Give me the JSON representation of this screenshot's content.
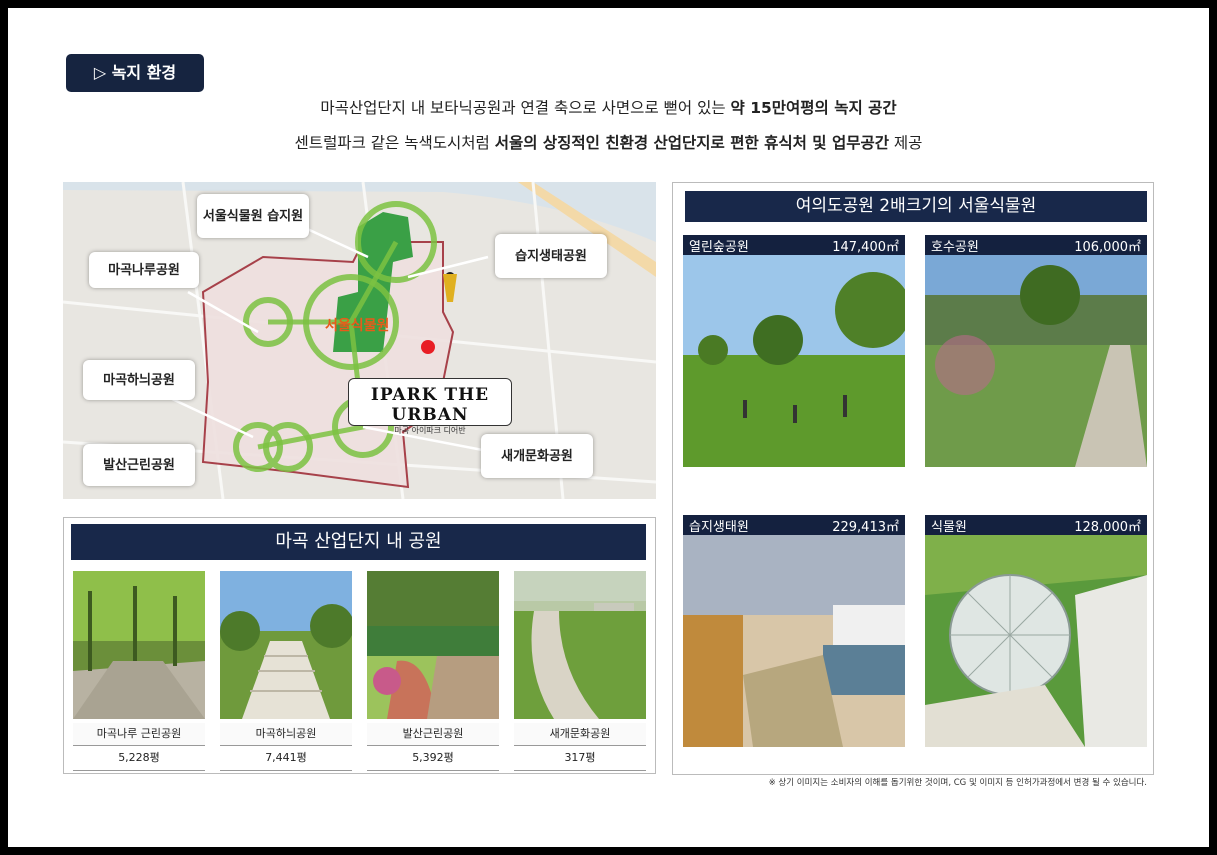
{
  "badge": "▷ 녹지 환경",
  "headline1": {
    "normal": "마곡산업단지 내 보타닉공원과 연결 축으로 사면으로 뻗어 있는 ",
    "bold": "약 15만여평의 녹지 공간"
  },
  "headline2": {
    "pre": "센트럴파크 같은 녹색도시처럼 ",
    "bold": "서울의 상징적인 친환경 산업단지로 편한 휴식처 및 업무공간",
    "post": " 제공"
  },
  "map": {
    "labels": [
      "서울식물원 습지원",
      "마곡나루공원",
      "마곡하늬공원",
      "발산근린공원",
      "습지생태공원",
      "새개문화공원"
    ],
    "center_label": "서울식물원",
    "ipark_logo": "IPARK THE URBAN",
    "ipark_sub": "마곡 아이파크 디어반"
  },
  "parks_panel": {
    "title": "마곡 산업단지 내 공원",
    "items": [
      {
        "name": "마곡나루 근린공원",
        "area": "5,228평"
      },
      {
        "name": "마곡하늬공원",
        "area": "7,441평"
      },
      {
        "name": "발산근린공원",
        "area": "5,392평"
      },
      {
        "name": "새개문화공원",
        "area": "317평"
      }
    ]
  },
  "botanic_panel": {
    "title": "여의도공원 2배크기의 서울식물원",
    "items": [
      {
        "name": "열린숲공원",
        "area": "147,400㎡"
      },
      {
        "name": "호수공원",
        "area": "106,000㎡"
      },
      {
        "name": "습지생태원",
        "area": "229,413㎡"
      },
      {
        "name": "식물원",
        "area": "128,000㎡"
      }
    ]
  },
  "note": "※ 상기 이미지는 소비자의 이해를 돕기위한 것이며, CG 및 이미지 등 인허가과정에서 변경 될 수 있습니다.",
  "colors": {
    "navy": "#18284a",
    "park_green": "#3aa046",
    "boundary": "#a0303a"
  }
}
